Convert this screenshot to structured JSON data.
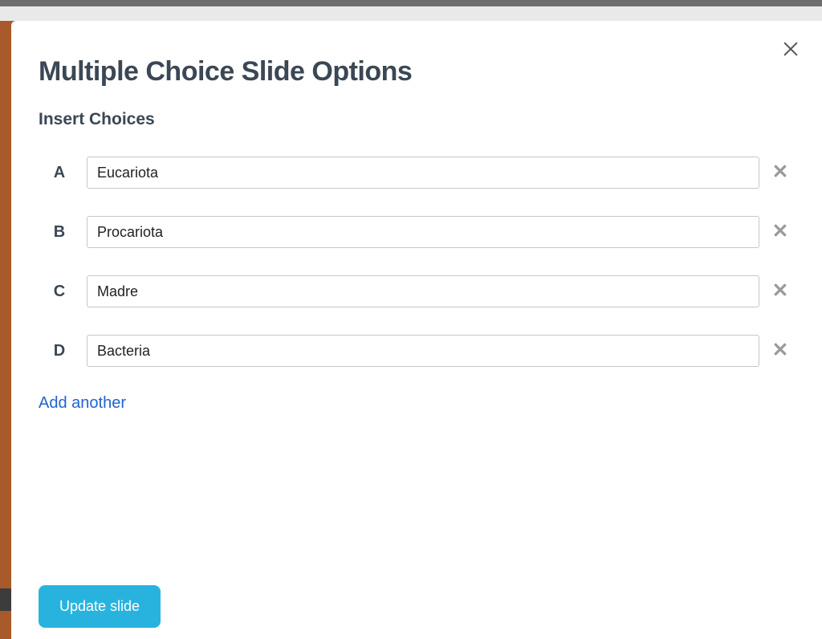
{
  "modal": {
    "title": "Multiple Choice Slide Options",
    "subtitle": "Insert Choices",
    "choices": [
      {
        "letter": "A",
        "value": "Eucariota"
      },
      {
        "letter": "B",
        "value": "Procariota"
      },
      {
        "letter": "C",
        "value": "Madre"
      },
      {
        "letter": "D",
        "value": "Bacteria"
      }
    ],
    "add_another_label": "Add another",
    "update_label": "Update slide"
  }
}
